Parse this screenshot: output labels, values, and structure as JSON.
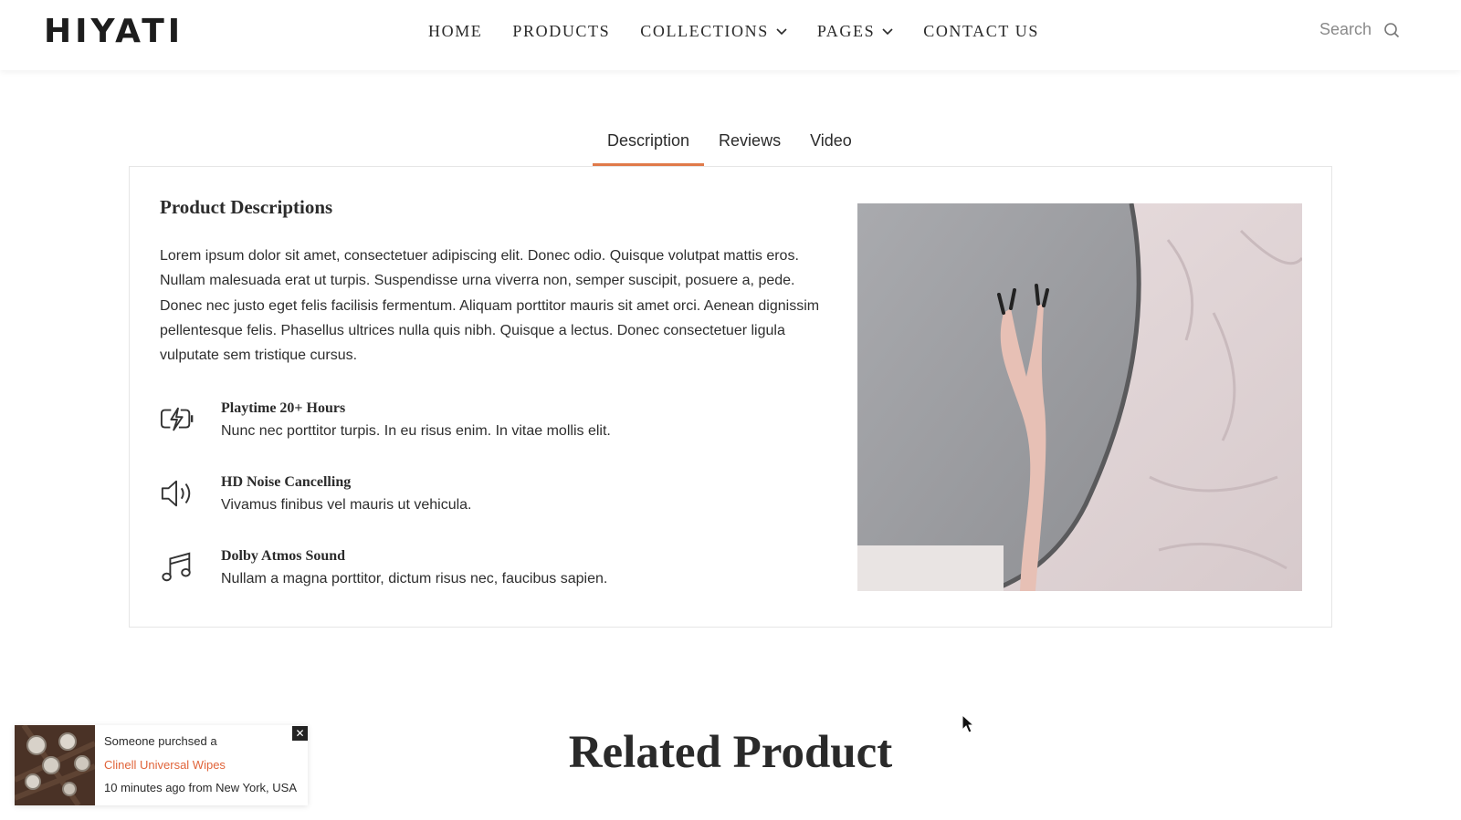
{
  "header": {
    "logo": "HIYATI",
    "nav": [
      {
        "label": "HOME",
        "has_dropdown": false
      },
      {
        "label": "PRODUCTS",
        "has_dropdown": false
      },
      {
        "label": "COLLECTIONS",
        "has_dropdown": true
      },
      {
        "label": "PAGES",
        "has_dropdown": true
      },
      {
        "label": "CONTACT US",
        "has_dropdown": false
      }
    ],
    "search": {
      "placeholder": "Search",
      "icon": "search-icon"
    }
  },
  "tabs": [
    {
      "label": "Description",
      "active": true
    },
    {
      "label": "Reviews",
      "active": false
    },
    {
      "label": "Video",
      "active": false
    }
  ],
  "description": {
    "title": "Product Descriptions",
    "body": "Lorem ipsum dolor sit amet, consectetuer adipiscing elit. Donec odio. Quisque volutpat mattis eros. Nullam malesuada erat ut turpis. Suspendisse urna viverra non, semper suscipit, posuere a, pede. Donec nec justo eget felis facilisis fermentum. Aliquam porttitor mauris sit amet orci. Aenean dignissim pellentesque felis. Phasellus ultrices nulla quis nibh. Quisque a lectus. Donec consectetuer ligula vulputate sem tristique cursus.",
    "features": [
      {
        "icon": "battery-charging-icon",
        "title": "Playtime 20+ Hours",
        "text": "Nunc nec porttitor turpis. In eu risus enim. In vitae mollis elit."
      },
      {
        "icon": "speaker-icon",
        "title": "HD Noise Cancelling",
        "text": "Vivamus finibus vel mauris ut vehicula."
      },
      {
        "icon": "music-note-icon",
        "title": "Dolby Atmos Sound",
        "text": "Nullam a magna porttitor, dictum risus nec, faucibus sapien."
      }
    ]
  },
  "related": {
    "title": "Related Product"
  },
  "toast": {
    "line1": "Someone purchsed a",
    "product": "Clinell Universal Wipes",
    "line3": "10 minutes ago from New York, USA",
    "close": "✕"
  },
  "colors": {
    "accent": "#e07a4a",
    "link": "#e0643a",
    "text": "#2b2b2b"
  }
}
